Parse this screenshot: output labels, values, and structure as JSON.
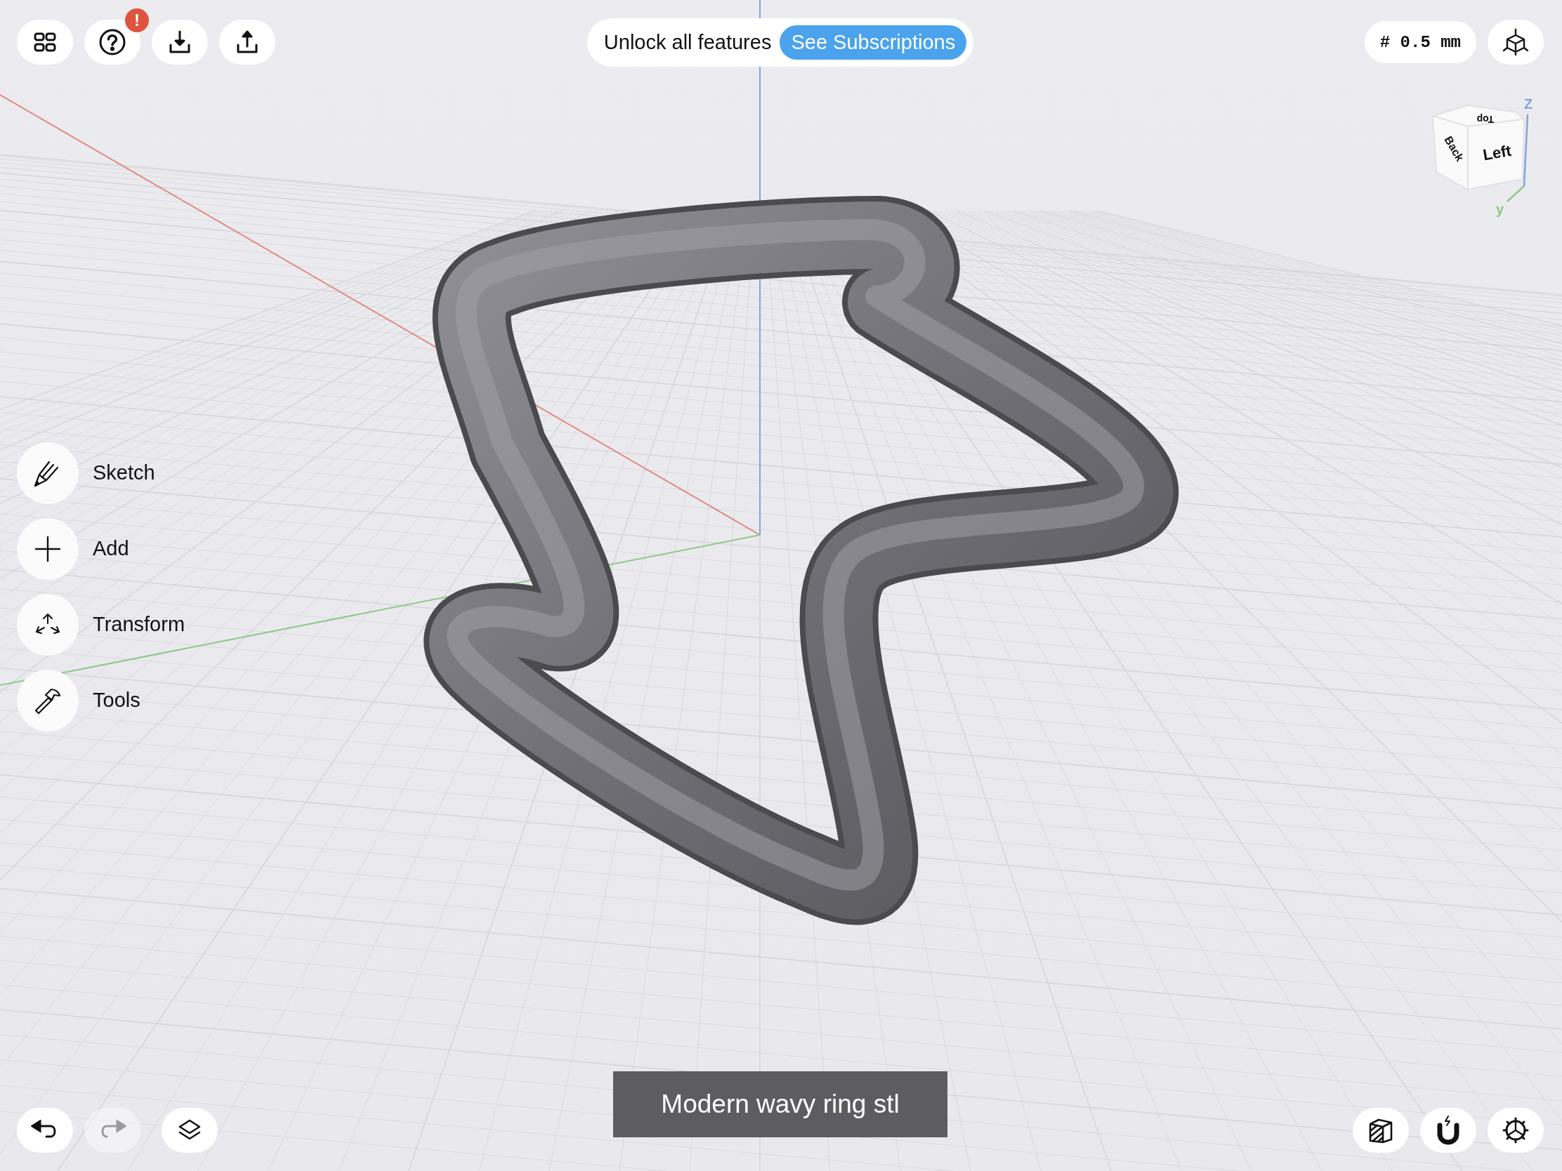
{
  "top_toolbar": {
    "help_badge": "!"
  },
  "promo": {
    "message": "Unlock all features",
    "action": "See Subscriptions"
  },
  "grid_size": "# 0.5 mm",
  "view_cube": {
    "faces": [
      {
        "kind": "top",
        "label": "Top"
      },
      {
        "kind": "back",
        "label": "Back"
      },
      {
        "kind": "left",
        "label": "Left"
      }
    ],
    "axes": [
      {
        "kind": "z",
        "label": "Z"
      },
      {
        "kind": "y",
        "label": "y"
      }
    ]
  },
  "tools": [
    {
      "kind": "sketch",
      "label": "Sketch"
    },
    {
      "kind": "add",
      "label": "Add"
    },
    {
      "kind": "transform",
      "label": "Transform"
    },
    {
      "kind": "tools",
      "label": "Tools"
    }
  ],
  "history": [
    {
      "kind": "undo",
      "disabled": false
    },
    {
      "kind": "redo",
      "disabled": true
    }
  ],
  "caption": "Modern wavy ring stl"
}
